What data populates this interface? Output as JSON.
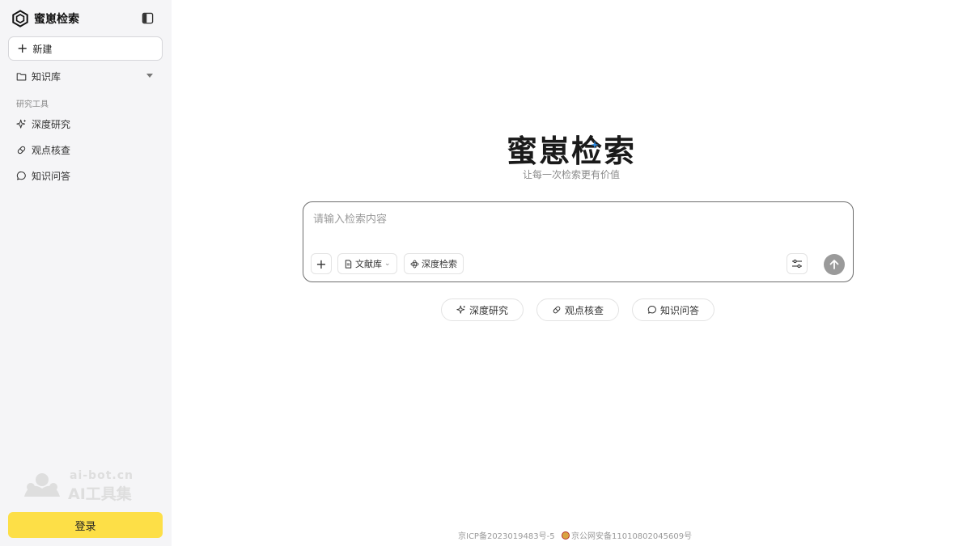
{
  "sidebar": {
    "brand": "蜜崽检索",
    "new_label": "新建",
    "knowledge_base": "知识库",
    "section_title": "研究工具",
    "tools": [
      {
        "label": "深度研究",
        "icon": "sparkle-icon"
      },
      {
        "label": "观点核查",
        "icon": "pill-icon"
      },
      {
        "label": "知识问答",
        "icon": "chat-bubble-icon"
      }
    ],
    "watermark_url": "ai-bot.cn",
    "watermark_name": "AI工具集",
    "login_label": "登录"
  },
  "hero": {
    "title": "蜜崽检索",
    "subtitle": "让每一次检索更有价值"
  },
  "search": {
    "placeholder": "请输入检索内容",
    "value": "",
    "library_label": "文献库",
    "deep_search_label": "深度检索"
  },
  "chips": [
    {
      "label": "深度研究"
    },
    {
      "label": "观点核查"
    },
    {
      "label": "知识问答"
    }
  ],
  "footer": {
    "icp": "京ICP备2023019483号-5",
    "police": "京公网安备11010802045609号"
  },
  "colors": {
    "sidebar_bg": "#f5f5f7",
    "login_bg": "#fddf47",
    "send_bg": "#9a9a9a",
    "border": "#6e6e6e"
  }
}
